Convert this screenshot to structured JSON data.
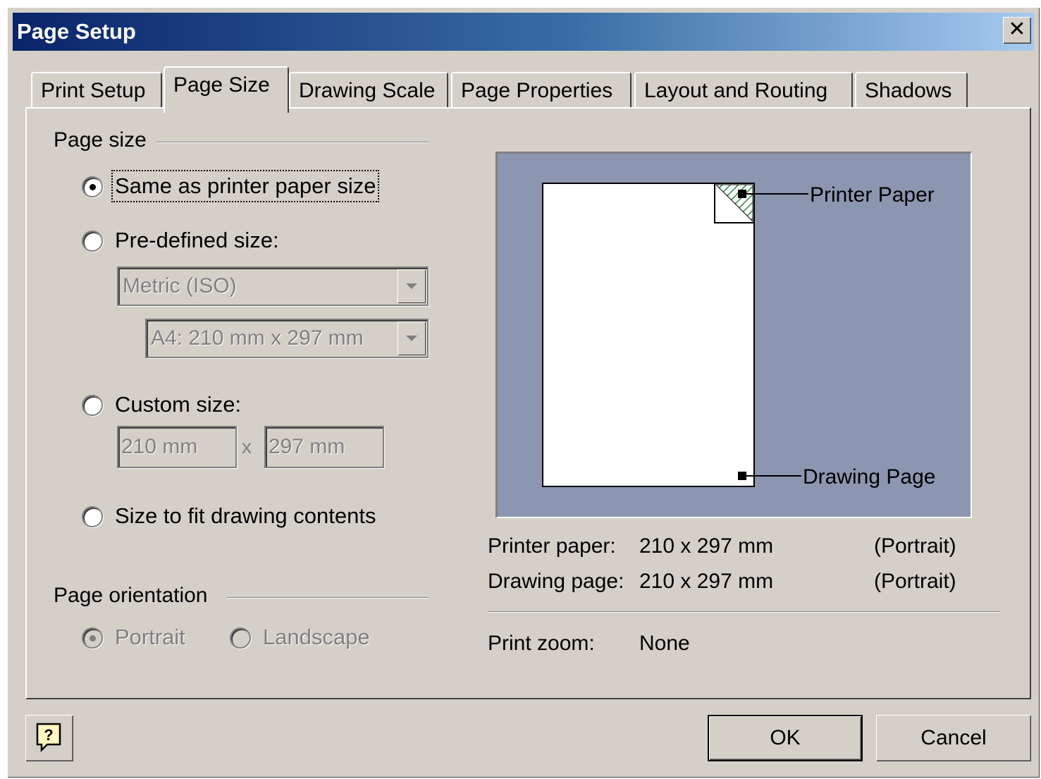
{
  "window": {
    "title": "Page Setup",
    "close_label": "✕"
  },
  "tabs": [
    {
      "label": "Print Setup"
    },
    {
      "label": "Page Size"
    },
    {
      "label": "Drawing Scale"
    },
    {
      "label": "Page Properties"
    },
    {
      "label": "Layout and Routing"
    },
    {
      "label": "Shadows"
    }
  ],
  "active_tab": "Page Size",
  "page_size": {
    "group_label": "Page size",
    "options": [
      {
        "label": "Same as printer paper size",
        "checked": true
      },
      {
        "label": "Pre-defined size:",
        "checked": false
      },
      {
        "label": "Custom size:",
        "checked": false
      },
      {
        "label": "Size to fit drawing contents",
        "checked": false
      }
    ],
    "predefined_standard": "Metric (ISO)",
    "predefined_size": "A4:  210 mm x 297 mm",
    "custom_width": "210 mm",
    "custom_separator": "x",
    "custom_height": "297 mm"
  },
  "orientation": {
    "group_label": "Page orientation",
    "portrait_label": "Portrait",
    "landscape_label": "Landscape",
    "selected": "Portrait"
  },
  "preview": {
    "printer_paper_label": "Printer Paper",
    "drawing_page_label": "Drawing Page",
    "background_color": "#8c96b0"
  },
  "info": {
    "printer_paper_label": "Printer paper:",
    "printer_paper_value": "210 x 297 mm",
    "printer_paper_orientation": "(Portrait)",
    "drawing_page_label": "Drawing page:",
    "drawing_page_value": "210 x 297 mm",
    "drawing_page_orientation": "(Portrait)",
    "print_zoom_label": "Print zoom:",
    "print_zoom_value": "None"
  },
  "buttons": {
    "ok": "OK",
    "cancel": "Cancel",
    "help_icon": "help-icon"
  },
  "colors": {
    "titlebar_start": "#0a246a",
    "titlebar_end": "#a6caf0",
    "dialog_face": "#d4d0c8"
  }
}
